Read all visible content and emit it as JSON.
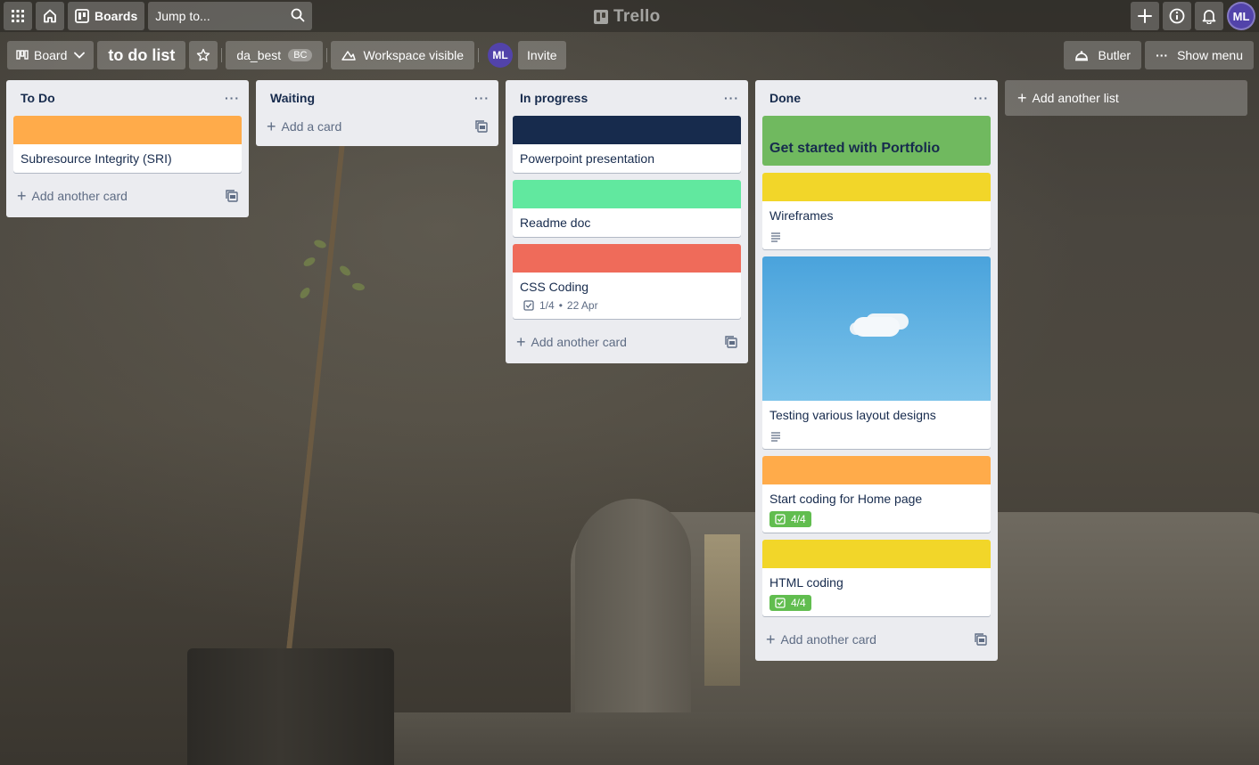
{
  "topbar": {
    "boards_label": "Boards",
    "search_placeholder": "Jump to...",
    "logo_text": "Trello",
    "avatar_initials": "ML"
  },
  "boardbar": {
    "view_label": "Board",
    "board_title": "to do list",
    "workspace_name": "da_best",
    "workspace_badge": "BC",
    "visibility_label": "Workspace visible",
    "member_initials": "ML",
    "invite_label": "Invite",
    "butler_label": "Butler",
    "show_menu_label": "Show menu"
  },
  "lists": [
    {
      "title": "To Do",
      "cards": [
        {
          "title": "Subresource Integrity (SRI)",
          "cover": "#ffab4a"
        }
      ],
      "add_label": "Add another card"
    },
    {
      "title": "Waiting",
      "cards": [],
      "add_label": "Add a card"
    },
    {
      "title": "In progress",
      "cards": [
        {
          "title": "Powerpoint presentation",
          "cover": "#172b4d"
        },
        {
          "title": "Readme doc",
          "cover": "#61e89f"
        },
        {
          "title": "CSS Coding",
          "cover": "#ef6b5a",
          "checklist": "1/4",
          "due": "22 Apr"
        }
      ],
      "add_label": "Add another card"
    },
    {
      "title": "Done",
      "cards": [
        {
          "title": "Get started with Portfolio",
          "cover": "#70b95f"
        },
        {
          "title": "Wireframes",
          "cover": "#f2d629",
          "has_description": true
        },
        {
          "title": "Testing various layout designs",
          "cover_image": "sky-with-cloud",
          "has_description": true
        },
        {
          "title": "Start coding for Home page",
          "cover": "#ffab4a",
          "checklist": "4/4"
        },
        {
          "title": "HTML coding",
          "cover": "#f2d629",
          "checklist": "4/4"
        }
      ],
      "add_label": "Add another card"
    }
  ],
  "add_list_label": "Add another list",
  "icons": {
    "apps": "grid-icon",
    "home": "home-icon",
    "boards": "board-icon",
    "search": "search-icon",
    "create": "plus-icon",
    "info": "info-icon",
    "notifications": "bell-icon",
    "star": "star-icon",
    "visibility": "people-icon",
    "butler": "butler-icon",
    "menu": "more-icon",
    "template": "template-icon",
    "checklist": "checkbox-icon",
    "description": "description-icon"
  }
}
